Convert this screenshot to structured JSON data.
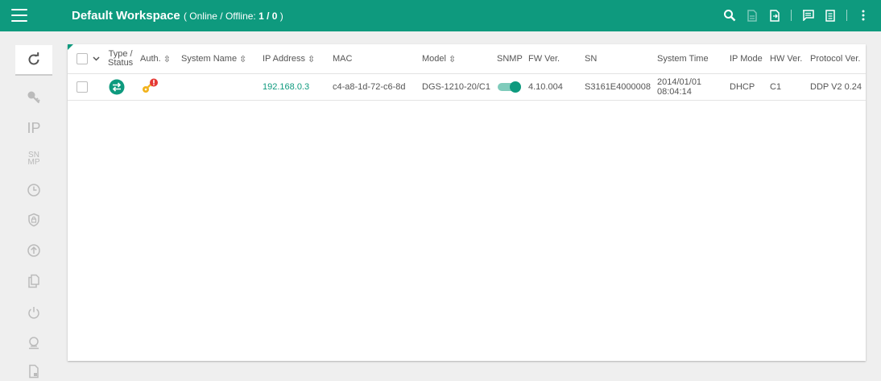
{
  "header": {
    "title": "Default Workspace",
    "status_prefix": "( Online / Offline: ",
    "status_counts": "1 / 0",
    "status_suffix": " )",
    "icons": [
      "search-icon",
      "export-file-icon",
      "import-file-icon",
      "message-icon",
      "document-list-icon",
      "more-vert-icon"
    ]
  },
  "sidebar": {
    "refresh_icon": "refresh-icon",
    "items": [
      {
        "name": "key-icon"
      },
      {
        "label": "IP"
      },
      {
        "label_top": "SN",
        "label_bottom": "MP"
      },
      {
        "name": "clock-icon"
      },
      {
        "name": "shield-lock-icon"
      },
      {
        "name": "upload-icon"
      },
      {
        "name": "copy-icon"
      },
      {
        "name": "power-icon"
      },
      {
        "name": "reset-icon"
      },
      {
        "name": "file-icon"
      }
    ]
  },
  "table": {
    "columns": {
      "type_line1": "Type /",
      "type_line2": "Status",
      "auth": "Auth.",
      "system_name": "System Name",
      "ip": "IP Address",
      "mac": "MAC",
      "model": "Model",
      "snmp": "SNMP",
      "fw": "FW Ver.",
      "sn": "SN",
      "system_time": "System Time",
      "ip_mode": "IP Mode",
      "hw": "HW Ver.",
      "protocol": "Protocol Ver."
    },
    "rows": [
      {
        "system_name": "",
        "ip": "192.168.0.3",
        "mac": "c4-a8-1d-72-c6-8d",
        "model": "DGS-1210-20/C1",
        "snmp_on": true,
        "fw": "4.10.004",
        "sn": "S3161E4000008",
        "date": "2014/01/01",
        "time": "08:04:14",
        "ip_mode": "DHCP",
        "hw": "C1",
        "protocol": "DDP V2 0.24"
      }
    ]
  },
  "colors": {
    "accent": "#0e9a7e",
    "alert": "#e53935",
    "key": "#f2b21b"
  }
}
